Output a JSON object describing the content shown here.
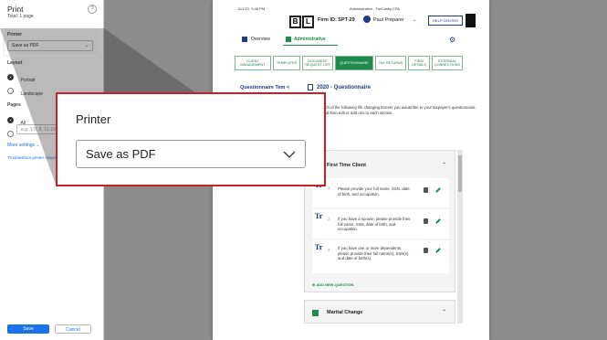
{
  "print_panel": {
    "title": "Print",
    "total": "Total: 1 page",
    "help_icon": "?",
    "printer_label": "Printer",
    "printer_value": "Save as PDF",
    "layout_label": "Layout",
    "layout_options": [
      "Portrait",
      "Landscape"
    ],
    "pages_label": "Pages",
    "pages_all": "All",
    "pages_placeholder": "e.g. 1-5, 8, 11-13",
    "more_settings": "More settings",
    "troubleshoot": "Troubleshoot printer issues",
    "save_button": "Save",
    "cancel_button": "Cancel"
  },
  "document": {
    "timestamp": "11/1/21, 3:48 PM",
    "header_title": "Administrative - TaxCastly CPA",
    "logo_letters": [
      "B",
      "L"
    ],
    "firm_id": "Firm ID: SPT-29",
    "user_name": "Paul Preparer",
    "help_center": "HELP CENTER",
    "nav_overview": "Overview",
    "nav_admin": "Administrative",
    "tabs": [
      "CLIENT MANAGEMENT",
      "TEMPLATES",
      "DOCUMENT REQUEST LIST",
      "QUESTIONNAIRE",
      "TAX RETURNS",
      "FIRM DETAILS",
      "EXTERNAL CONNECTIONS"
    ],
    "active_tab_index": 3,
    "back_link": "Questionnaire Tem",
    "questionnaire_title": "2020 - Questionnaire",
    "intro": "hich of the following life changing Events you would like to your taxpayer's questionnaire, and then edit or add ons to each section.",
    "all_label": "ll",
    "section1_title": "First Time Client",
    "questions": [
      {
        "num": "1",
        "text": "Please provide your full name, SSN, date of birth, and occupation."
      },
      {
        "num": "2",
        "text": "If you have a spouse, please provide their full name, SSN, date of birth, and occupation."
      },
      {
        "num": "3",
        "text": "If you have one or more dependents, please provide their full name(s), SSN(s), and date of birth(s)."
      }
    ],
    "tr_glyph": "Tr",
    "add_question": "ADD NEW QUESTION",
    "section2_title": "Marital Change"
  },
  "zoom": {
    "title": "Printer",
    "value": "Save as PDF"
  },
  "colors": {
    "green": "#1f8a4c",
    "navy": "#1e3a8a",
    "callout_border": "#c8202a",
    "save_blue": "#1a73e8"
  }
}
